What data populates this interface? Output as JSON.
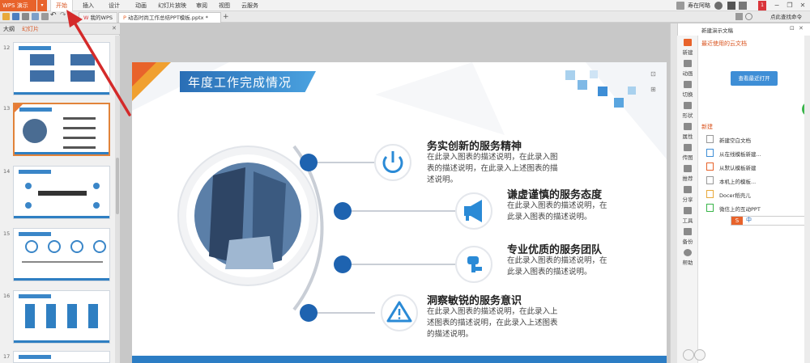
{
  "app": {
    "logo": "WPS 演示",
    "logo_dropdown": "▾"
  },
  "menu": {
    "items": [
      "开始",
      "插入",
      "设计",
      "动画",
      "幻灯片放映",
      "审阅",
      "视图",
      "云服务"
    ],
    "active": "开始"
  },
  "user": {
    "name": "寿在阿略",
    "unread_badge": "1"
  },
  "tabs": {
    "items": [
      {
        "label": "我的WPS"
      },
      {
        "label": "动态时尚工作总结PPT模板.pptx *"
      }
    ],
    "add": "+",
    "share": "点此查找命令"
  },
  "left_panel": {
    "tabs": [
      "大纲",
      "幻灯片"
    ],
    "thumbnails": [
      {
        "num": "12"
      },
      {
        "num": "13"
      },
      {
        "num": "14"
      },
      {
        "num": "15"
      },
      {
        "num": "16"
      },
      {
        "num": "17"
      }
    ]
  },
  "slide": {
    "title": "年度工作完成情况",
    "items": [
      {
        "title": "务实创新的服务精神",
        "desc": "在此录入图表的描述说明，在此录入图表的描述说明，在此录入上述图表的描述说明。",
        "icon": "power-icon"
      },
      {
        "title": "谦虚谨慎的服务态度",
        "desc": "在此录入图表的描述说明，在此录入图表的描述说明。",
        "icon": "megaphone-icon"
      },
      {
        "title": "专业优质的服务团队",
        "desc": "在此录入图表的描述说明，在此录入图表的描述说明。",
        "icon": "parking-icon"
      },
      {
        "title": "洞察敏锐的服务意识",
        "desc": "在此录入图表的描述说明，在此录入上述图表的描述说明，在此录入上述图表的描述说明。",
        "icon": "warning-icon"
      }
    ]
  },
  "right_panel": {
    "title": "新建演示文稿",
    "recent": "最近使用的云文档",
    "open_button": "查看最近打开",
    "new_label": "新建",
    "new_items": [
      "新建空白文档",
      "从在线模板新建...",
      "从默认模板新建",
      "本机上的模板...",
      "Docer稻壳儿",
      "微信上的互动PPT"
    ],
    "side_tabs": [
      "新建",
      "动画",
      "切换",
      "形状",
      "属性",
      "传图",
      "推荐",
      "分享",
      "工具",
      "备份",
      "帮助"
    ]
  },
  "colors": {
    "accent_orange": "#e8632b",
    "slide_blue": "#2c7dc4",
    "dot_blue": "#1e63b0"
  }
}
